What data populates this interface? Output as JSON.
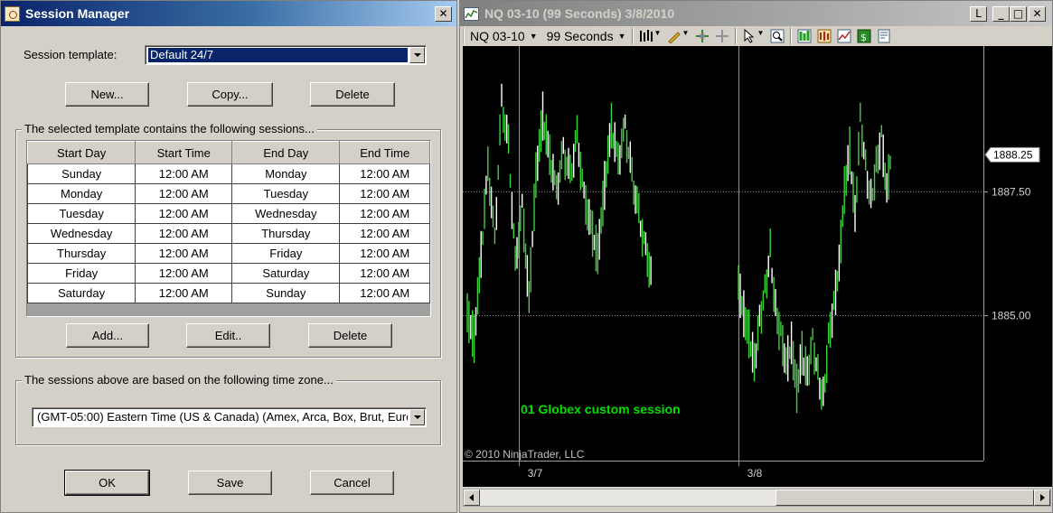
{
  "session_manager": {
    "title": "Session Manager",
    "close_glyph": "✕",
    "template_label": "Session template:",
    "template_value": "Default 24/7",
    "buttons": {
      "new": "New...",
      "copy": "Copy...",
      "delete": "Delete"
    },
    "sessions_legend": "The selected template contains the following sessions...",
    "columns": [
      "Start Day",
      "Start Time",
      "End Day",
      "End Time"
    ],
    "rows": [
      [
        "Sunday",
        "12:00 AM",
        "Monday",
        "12:00 AM"
      ],
      [
        "Monday",
        "12:00 AM",
        "Tuesday",
        "12:00 AM"
      ],
      [
        "Tuesday",
        "12:00 AM",
        "Wednesday",
        "12:00 AM"
      ],
      [
        "Wednesday",
        "12:00 AM",
        "Thursday",
        "12:00 AM"
      ],
      [
        "Thursday",
        "12:00 AM",
        "Friday",
        "12:00 AM"
      ],
      [
        "Friday",
        "12:00 AM",
        "Saturday",
        "12:00 AM"
      ],
      [
        "Saturday",
        "12:00 AM",
        "Sunday",
        "12:00 AM"
      ]
    ],
    "session_buttons": {
      "add": "Add...",
      "edit": "Edit..",
      "delete": "Delete"
    },
    "timezone_legend": "The sessions above are based on the following time zone...",
    "timezone_value": "(GMT-05:00) Eastern Time (US & Canada) (Amex, Arca, Box, Brut, Euro",
    "footer_buttons": {
      "ok": "OK",
      "save": "Save",
      "cancel": "Cancel"
    }
  },
  "chart_window": {
    "title": "NQ 03-10 (99 Seconds)  3/8/2010",
    "caption_buttons": [
      "L",
      "_",
      "□",
      "✕"
    ],
    "toolbar": {
      "instrument": "NQ 03-10",
      "interval": "99 Seconds"
    },
    "colors": {
      "background": "#000000",
      "up_bar": "#3cd23c",
      "down_bar": "#ffffff",
      "gridline": "#888888",
      "annotation": "#00e000"
    }
  },
  "chart_data": {
    "type": "line",
    "title": "",
    "annotation": "01 Globex custom session",
    "copyright": "© 2010 NinjaTrader, LLC",
    "x_tick_labels": [
      "3/7",
      "3/8"
    ],
    "y_tick_labels": [
      "1887.50",
      "1885.00"
    ],
    "y_ticks": [
      1887.5,
      1885.0
    ],
    "last_price": 1888.25,
    "last_price_label": "1888.25",
    "ylim": [
      1883.0,
      1890.3
    ],
    "grid": true,
    "series": [
      {
        "values": [
          1885.0,
          1884.5,
          1886.2,
          1888.0,
          1886.5,
          1889.3,
          1888.4,
          1886.0,
          1887.2,
          1885.3,
          1887.8,
          1889.0,
          1888.2,
          1887.5,
          1888.3,
          1887.8,
          1888.6,
          1887.4,
          1886.8,
          1886.2,
          1887.6,
          1888.8,
          1888.1,
          1888.8,
          1887.8,
          1887.0,
          1886.3,
          1885.7,
          1885.6,
          1885.0,
          1884.6,
          1884.0,
          1884.9,
          1885.5,
          1886.3,
          1885.1,
          1884.6,
          1884.0,
          1884.4,
          1883.5,
          1884.2,
          1883.8,
          1884.5,
          1883.8,
          1883.3,
          1884.5,
          1885.2,
          1886.0,
          1887.5,
          1888.3,
          1887.0,
          1889.0,
          1888.0,
          1887.3,
          1888.0,
          1888.6,
          1887.5,
          1888.4
        ]
      }
    ]
  }
}
